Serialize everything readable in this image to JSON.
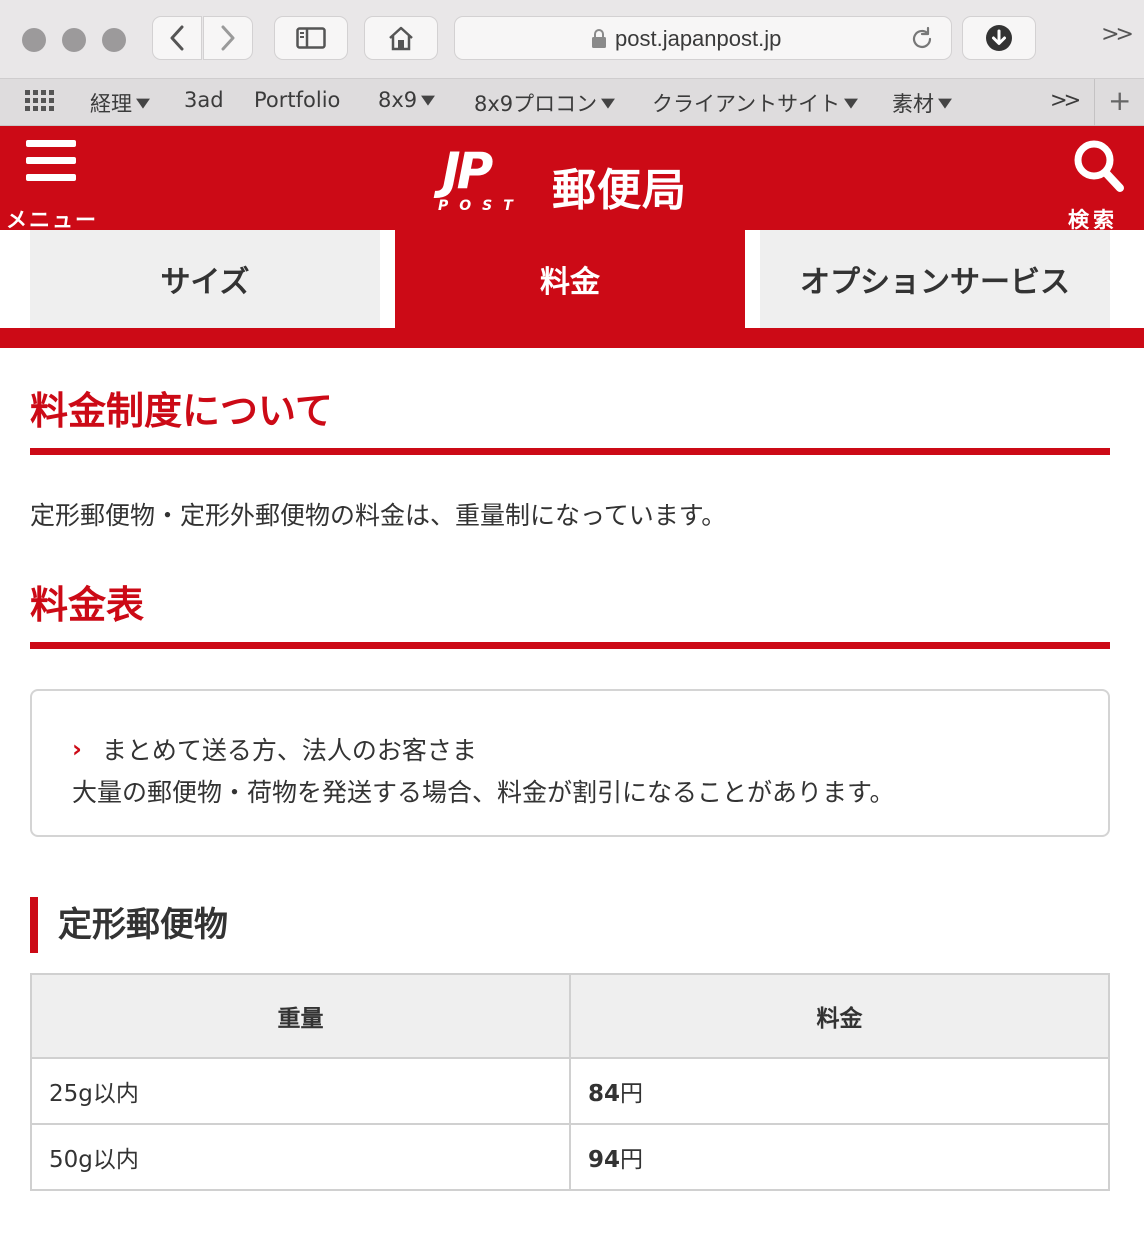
{
  "browser": {
    "url": "post.japanpost.jp",
    "more_label": ">>",
    "bookmarks": [
      {
        "label": "経理",
        "has_menu": true
      },
      {
        "label": "3ad",
        "has_menu": false
      },
      {
        "label": "Portfolio",
        "has_menu": false
      },
      {
        "label": "8x9",
        "has_menu": true
      },
      {
        "label": "8x9プロコン",
        "has_menu": true
      },
      {
        "label": "クライアントサイト",
        "has_menu": true
      },
      {
        "label": "素材",
        "has_menu": true
      }
    ],
    "bookmarks_more": ">>",
    "add_tab": "+"
  },
  "header": {
    "menu_label": "メニュー",
    "logo_mark": "JP",
    "logo_sub": "POST",
    "site_name": "郵便局",
    "search_label": "検索",
    "bg_color": "#cc0a16"
  },
  "tabs": [
    {
      "label": "サイズ",
      "active": false
    },
    {
      "label": "料金",
      "active": true
    },
    {
      "label": "オプションサービス",
      "active": false
    }
  ],
  "content": {
    "section1_title": "料金制度について",
    "section1_text": "定形郵便物・定形外郵便物の料金は、重量制になっています。",
    "section2_title": "料金表",
    "notice": {
      "arrow": "›",
      "link_text": "まとめて送る方、法人のお客さま",
      "text": "大量の郵便物・荷物を発送する場合、料金が割引になることがあります。"
    },
    "subsection_title": "定形郵便物",
    "table": {
      "headers": [
        "重量",
        "料金"
      ],
      "rows": [
        {
          "weight": "25g以内",
          "price_num": "84",
          "price_unit": "円"
        },
        {
          "weight": "50g以内",
          "price_num": "94",
          "price_unit": "円"
        }
      ]
    }
  }
}
